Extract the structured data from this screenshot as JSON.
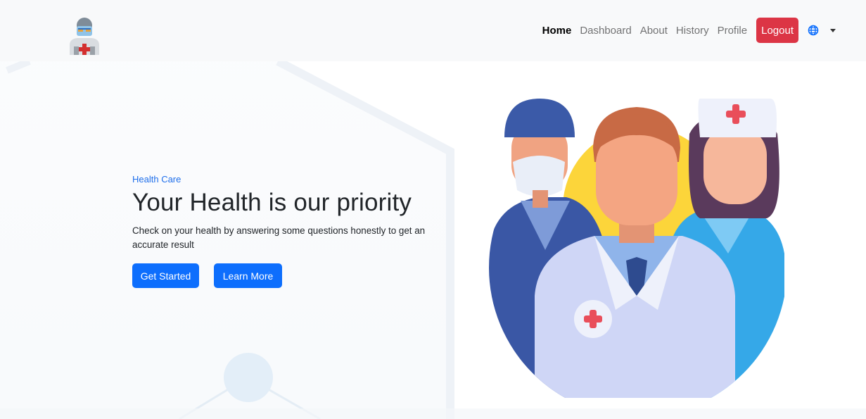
{
  "nav": {
    "links": [
      {
        "label": "Home",
        "active": true
      },
      {
        "label": "Dashboard"
      },
      {
        "label": "About"
      },
      {
        "label": "History"
      },
      {
        "label": "Profile"
      }
    ],
    "logout_label": "Logout",
    "language_icon": "globe-icon",
    "dropdown_icon": "caret-down-icon"
  },
  "hero": {
    "eyebrow": "Health Care",
    "title": "Your Health is our priority",
    "description": "Check on your health by answering some questions honestly to get an accurate result",
    "get_started_label": "Get Started",
    "learn_more_label": "Learn More"
  },
  "colors": {
    "primary": "#0d6efd",
    "danger": "#dc3545",
    "eyebrow": "#1f6feb",
    "navbar_bg": "#f8f9fa"
  }
}
